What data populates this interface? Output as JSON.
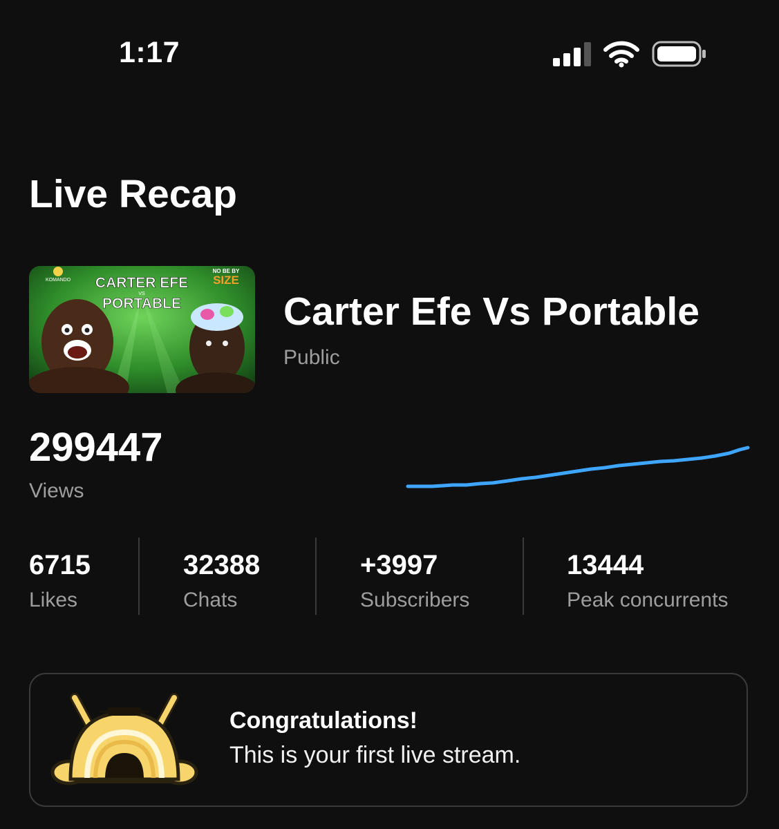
{
  "status_bar": {
    "time": "1:17",
    "icons": [
      "cellular-signal-icon",
      "wifi-icon",
      "battery-icon"
    ]
  },
  "page": {
    "title": "Live Recap"
  },
  "video": {
    "title": "Carter Efe Vs Portable",
    "visibility": "Public",
    "thumbnail": {
      "headline_line1": "CARTER EFE",
      "headline_vs": "VS",
      "headline_line2": "PORTABLE",
      "tag_small": "NO BE BY",
      "tag_big": "SIZE",
      "logo_text": "KOMANDO"
    }
  },
  "views": {
    "count": "299447",
    "label": "Views",
    "trend_color": "#3ea6ff"
  },
  "stats": [
    {
      "value": "6715",
      "label": "Likes"
    },
    {
      "value": "32388",
      "label": "Chats"
    },
    {
      "value": "+3997",
      "label": "Subscribers"
    },
    {
      "value": "13444",
      "label": "Peak concurrents"
    }
  ],
  "congrats": {
    "title": "Congratulations!",
    "message": "This is your first live stream.",
    "badge_icon": "first-stream-badge-icon"
  },
  "colors": {
    "background": "#0f0f0f",
    "primary_text": "#f1f1f1",
    "secondary_text": "#9e9e9e",
    "accent": "#3ea6ff",
    "badge_yellow": "#f7d56b"
  }
}
